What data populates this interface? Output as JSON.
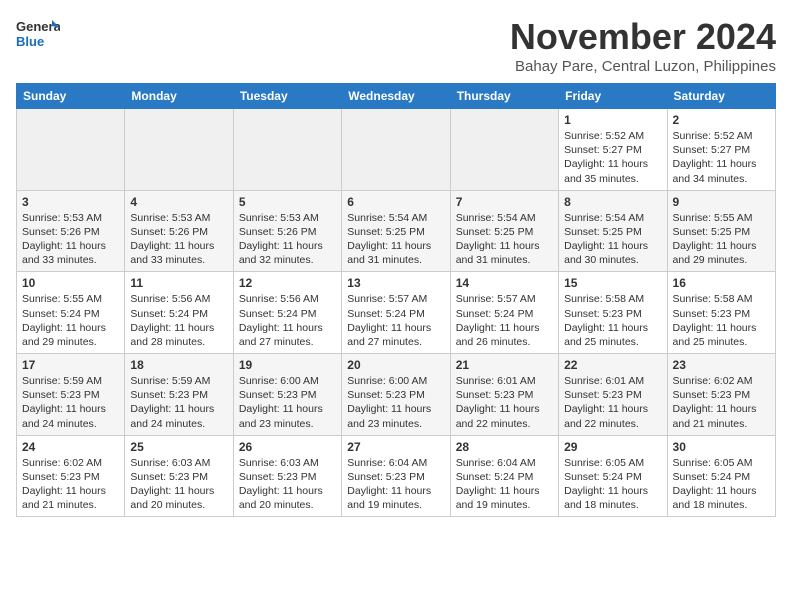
{
  "header": {
    "logo_line1": "General",
    "logo_line2": "Blue",
    "month_year": "November 2024",
    "location": "Bahay Pare, Central Luzon, Philippines"
  },
  "days_of_week": [
    "Sunday",
    "Monday",
    "Tuesday",
    "Wednesday",
    "Thursday",
    "Friday",
    "Saturday"
  ],
  "weeks": [
    [
      {
        "day": "",
        "content": ""
      },
      {
        "day": "",
        "content": ""
      },
      {
        "day": "",
        "content": ""
      },
      {
        "day": "",
        "content": ""
      },
      {
        "day": "",
        "content": ""
      },
      {
        "day": "1",
        "content": "Sunrise: 5:52 AM\nSunset: 5:27 PM\nDaylight: 11 hours and 35 minutes."
      },
      {
        "day": "2",
        "content": "Sunrise: 5:52 AM\nSunset: 5:27 PM\nDaylight: 11 hours and 34 minutes."
      }
    ],
    [
      {
        "day": "3",
        "content": "Sunrise: 5:53 AM\nSunset: 5:26 PM\nDaylight: 11 hours and 33 minutes."
      },
      {
        "day": "4",
        "content": "Sunrise: 5:53 AM\nSunset: 5:26 PM\nDaylight: 11 hours and 33 minutes."
      },
      {
        "day": "5",
        "content": "Sunrise: 5:53 AM\nSunset: 5:26 PM\nDaylight: 11 hours and 32 minutes."
      },
      {
        "day": "6",
        "content": "Sunrise: 5:54 AM\nSunset: 5:25 PM\nDaylight: 11 hours and 31 minutes."
      },
      {
        "day": "7",
        "content": "Sunrise: 5:54 AM\nSunset: 5:25 PM\nDaylight: 11 hours and 31 minutes."
      },
      {
        "day": "8",
        "content": "Sunrise: 5:54 AM\nSunset: 5:25 PM\nDaylight: 11 hours and 30 minutes."
      },
      {
        "day": "9",
        "content": "Sunrise: 5:55 AM\nSunset: 5:25 PM\nDaylight: 11 hours and 29 minutes."
      }
    ],
    [
      {
        "day": "10",
        "content": "Sunrise: 5:55 AM\nSunset: 5:24 PM\nDaylight: 11 hours and 29 minutes."
      },
      {
        "day": "11",
        "content": "Sunrise: 5:56 AM\nSunset: 5:24 PM\nDaylight: 11 hours and 28 minutes."
      },
      {
        "day": "12",
        "content": "Sunrise: 5:56 AM\nSunset: 5:24 PM\nDaylight: 11 hours and 27 minutes."
      },
      {
        "day": "13",
        "content": "Sunrise: 5:57 AM\nSunset: 5:24 PM\nDaylight: 11 hours and 27 minutes."
      },
      {
        "day": "14",
        "content": "Sunrise: 5:57 AM\nSunset: 5:24 PM\nDaylight: 11 hours and 26 minutes."
      },
      {
        "day": "15",
        "content": "Sunrise: 5:58 AM\nSunset: 5:23 PM\nDaylight: 11 hours and 25 minutes."
      },
      {
        "day": "16",
        "content": "Sunrise: 5:58 AM\nSunset: 5:23 PM\nDaylight: 11 hours and 25 minutes."
      }
    ],
    [
      {
        "day": "17",
        "content": "Sunrise: 5:59 AM\nSunset: 5:23 PM\nDaylight: 11 hours and 24 minutes."
      },
      {
        "day": "18",
        "content": "Sunrise: 5:59 AM\nSunset: 5:23 PM\nDaylight: 11 hours and 24 minutes."
      },
      {
        "day": "19",
        "content": "Sunrise: 6:00 AM\nSunset: 5:23 PM\nDaylight: 11 hours and 23 minutes."
      },
      {
        "day": "20",
        "content": "Sunrise: 6:00 AM\nSunset: 5:23 PM\nDaylight: 11 hours and 23 minutes."
      },
      {
        "day": "21",
        "content": "Sunrise: 6:01 AM\nSunset: 5:23 PM\nDaylight: 11 hours and 22 minutes."
      },
      {
        "day": "22",
        "content": "Sunrise: 6:01 AM\nSunset: 5:23 PM\nDaylight: 11 hours and 22 minutes."
      },
      {
        "day": "23",
        "content": "Sunrise: 6:02 AM\nSunset: 5:23 PM\nDaylight: 11 hours and 21 minutes."
      }
    ],
    [
      {
        "day": "24",
        "content": "Sunrise: 6:02 AM\nSunset: 5:23 PM\nDaylight: 11 hours and 21 minutes."
      },
      {
        "day": "25",
        "content": "Sunrise: 6:03 AM\nSunset: 5:23 PM\nDaylight: 11 hours and 20 minutes."
      },
      {
        "day": "26",
        "content": "Sunrise: 6:03 AM\nSunset: 5:23 PM\nDaylight: 11 hours and 20 minutes."
      },
      {
        "day": "27",
        "content": "Sunrise: 6:04 AM\nSunset: 5:23 PM\nDaylight: 11 hours and 19 minutes."
      },
      {
        "day": "28",
        "content": "Sunrise: 6:04 AM\nSunset: 5:24 PM\nDaylight: 11 hours and 19 minutes."
      },
      {
        "day": "29",
        "content": "Sunrise: 6:05 AM\nSunset: 5:24 PM\nDaylight: 11 hours and 18 minutes."
      },
      {
        "day": "30",
        "content": "Sunrise: 6:05 AM\nSunset: 5:24 PM\nDaylight: 11 hours and 18 minutes."
      }
    ]
  ]
}
